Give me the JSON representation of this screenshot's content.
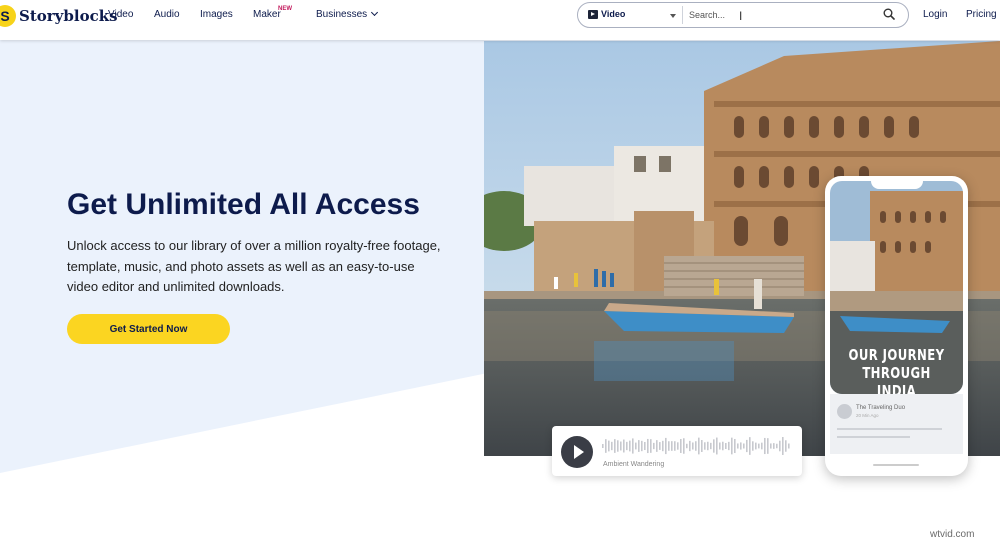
{
  "header": {
    "logo_mark": "S",
    "logo_text": "Storyblocks",
    "nav": [
      {
        "label": "Video"
      },
      {
        "label": "Audio"
      },
      {
        "label": "Images"
      },
      {
        "label": "Maker",
        "badge": "NEW"
      },
      {
        "label": "Businesses"
      }
    ],
    "search": {
      "type_selected": "Video",
      "placeholder": "Search...",
      "value": ""
    },
    "login_label": "Login",
    "pricing_label": "Pricing"
  },
  "hero": {
    "title": "Get Unlimited All Access",
    "description": "Unlock access to our library of over a million royalty-free footage, template, music, and photo assets as well as an easy-to-use video editor and unlimited downloads.",
    "cta_label": "Get Started Now"
  },
  "audio_card": {
    "track_name": "Ambient Wandering"
  },
  "phone": {
    "title_line1": "OUR JOURNEY",
    "title_line2": "THROUGH INDIA",
    "author": "The Traveling Duo",
    "time": "20 Min Ago"
  },
  "watermark": "wtvid.com",
  "colors": {
    "navy": "#0d1b4c",
    "yellow": "#fbd521",
    "hero_bg": "#ebf2fc",
    "badge": "#c2185b"
  }
}
